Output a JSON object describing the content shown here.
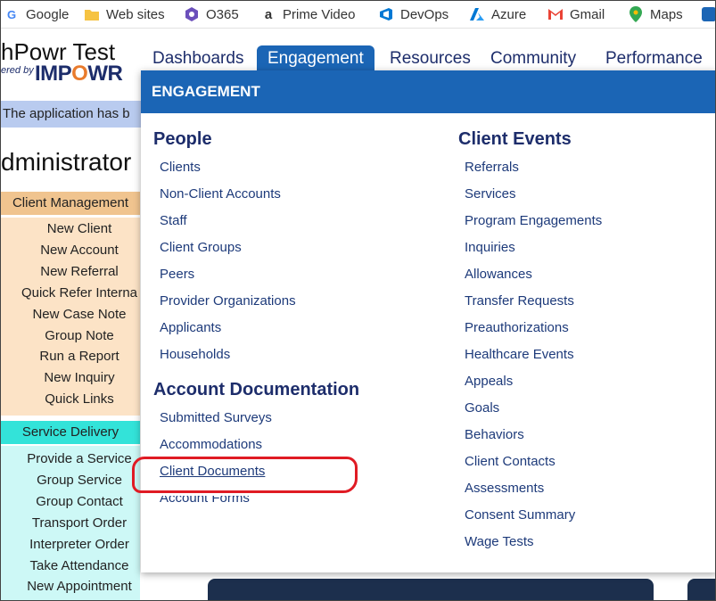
{
  "bookmarks": [
    {
      "label": "Google",
      "icon": "google-icon",
      "color": "#4285f4"
    },
    {
      "label": "Web sites",
      "icon": "folder-icon",
      "color": "#f6c343"
    },
    {
      "label": "O365",
      "icon": "office-icon",
      "color": "#6b4fbb"
    },
    {
      "label": "Prime Video",
      "icon": "amazon-icon",
      "color": "#111111"
    },
    {
      "label": "DevOps",
      "icon": "devops-icon",
      "color": "#0078d4"
    },
    {
      "label": "Azure",
      "icon": "azure-icon",
      "color": "#0078d4"
    },
    {
      "label": "Gmail",
      "icon": "gmail-icon",
      "color": "#ea4335"
    },
    {
      "label": "Maps",
      "icon": "maps-icon",
      "color": "#34a853"
    }
  ],
  "app": {
    "title": "hPowr Test",
    "powered_by": "ered by",
    "brand_pre": "IMP",
    "brand_o": "O",
    "brand_post": "WR",
    "notice": "The application has b"
  },
  "nav": {
    "items": [
      "Dashboards",
      "Engagement",
      "Resources",
      "Community",
      "Performance"
    ],
    "active": "Engagement"
  },
  "sidebar": {
    "heading": "dministrator",
    "client_management": {
      "title": "Client Management",
      "items": [
        "New Client",
        "New Account",
        "New Referral",
        "Quick Refer Interna",
        "New Case Note",
        "Group Note",
        "Run a Report",
        "New Inquiry",
        "Quick Links"
      ]
    },
    "service_delivery": {
      "title": "Service Delivery",
      "items": [
        "Provide a Service",
        "Group Service",
        "Group Contact",
        "Transport Order",
        "Interpreter Order",
        "Take Attendance",
        "New Appointment"
      ]
    }
  },
  "dropdown": {
    "header": "ENGAGEMENT",
    "people": {
      "title": "People",
      "items": [
        "Clients",
        "Non-Client Accounts",
        "Staff",
        "Client Groups",
        "Peers",
        "Provider Organizations",
        "Applicants",
        "Households"
      ]
    },
    "account_documentation": {
      "title": "Account Documentation",
      "items": [
        "Submitted Surveys",
        "Accommodations",
        "Client Documents",
        "Account Forms"
      ]
    },
    "client_events": {
      "title": "Client Events",
      "items": [
        "Referrals",
        "Services",
        "Program Engagements",
        "Inquiries",
        "Allowances",
        "Transfer Requests",
        "Preauthorizations",
        "Healthcare Events",
        "Appeals",
        "Goals",
        "Behaviors",
        "Client Contacts",
        "Assessments",
        "Consent Summary",
        "Wage Tests"
      ]
    }
  },
  "colors": {
    "accent": "#1b65b5",
    "nav_text": "#1d2d6b",
    "highlight": "#e01b24",
    "client_mgmt": "#f0c48f",
    "service_delivery": "#33e3d9"
  }
}
